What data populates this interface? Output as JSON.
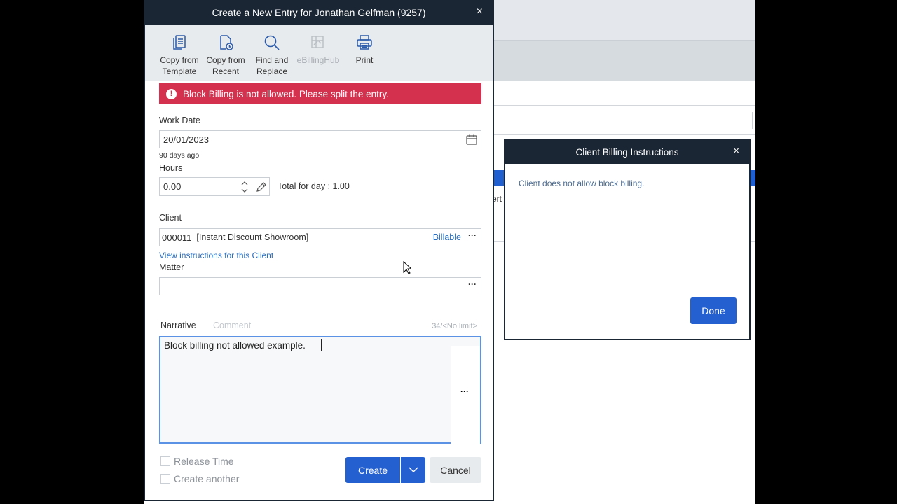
{
  "dialog": {
    "title": "Create a New Entry for Jonathan Gelfman (9257)",
    "close_glyph": "×"
  },
  "toolbar": {
    "items": [
      {
        "label": "Copy from\nTemplate",
        "icon": "copy-template-icon",
        "enabled": true
      },
      {
        "label": "Copy from\nRecent",
        "icon": "copy-recent-icon",
        "enabled": true
      },
      {
        "label": "Find and\nReplace",
        "icon": "search-icon",
        "enabled": true
      },
      {
        "label": "eBillingHub",
        "icon": "ebillinghub-icon",
        "enabled": false
      },
      {
        "label": "Print",
        "icon": "print-icon",
        "enabled": true
      }
    ]
  },
  "error": {
    "message": "Block Billing is not allowed. Please split the entry.",
    "icon_glyph": "!",
    "color": "#d4314f"
  },
  "work_date": {
    "label": "Work Date",
    "value": "20/01/2023",
    "relative": "90 days ago"
  },
  "hours": {
    "label": "Hours",
    "value": "0.00",
    "total_text": "Total for day : 1.00"
  },
  "client": {
    "label": "Client",
    "value": "000011",
    "name": "[Instant Discount Showroom]",
    "status": "Billable",
    "instructions_link": "View instructions for this Client"
  },
  "matter": {
    "label": "Matter",
    "value": ""
  },
  "narrative": {
    "tab_label": "Narrative",
    "comment_tab": "Comment",
    "counter": "34/<No limit>",
    "text": "Block billing not allowed example."
  },
  "options": {
    "release_time": "Release Time",
    "create_another": "Create another"
  },
  "buttons": {
    "create": "Create",
    "cancel": "Cancel"
  },
  "billing_dialog": {
    "title": "Client Billing Instructions",
    "close_glyph": "×",
    "message": "Client does not allow block billing.",
    "done": "Done"
  },
  "background": {
    "partial_text": "ert"
  },
  "colors": {
    "accent": "#2460cf",
    "title_bar": "#1b2634",
    "link": "#2a6ebd"
  }
}
